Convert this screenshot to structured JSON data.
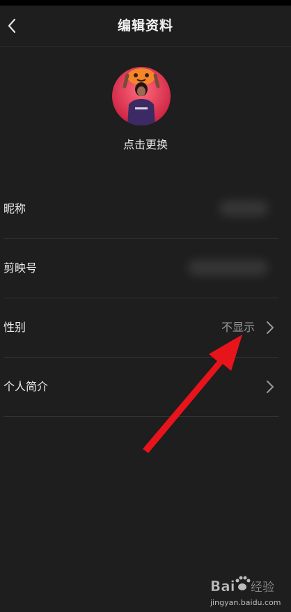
{
  "header": {
    "title": "编辑资料",
    "back_icon": "chevron-left-icon"
  },
  "avatar": {
    "change_label": "点击更换"
  },
  "profile_rows": [
    {
      "label": "昵称",
      "value": "",
      "value_hidden": true
    },
    {
      "label": "剪映号",
      "value": "",
      "value_hidden": true
    },
    {
      "label": "性别",
      "value": "不显示",
      "has_chevron": true
    },
    {
      "label": "个人简介",
      "value": "",
      "has_chevron": true
    }
  ],
  "annotation": {
    "arrow_color": "#e8141b"
  },
  "watermark": {
    "brand": "Bai度经验",
    "url": "jingyan.baidu.com"
  },
  "colors": {
    "background": "#1e1e1e",
    "text": "#ededed",
    "muted": "#9a9a9a",
    "divider": "#333333"
  }
}
